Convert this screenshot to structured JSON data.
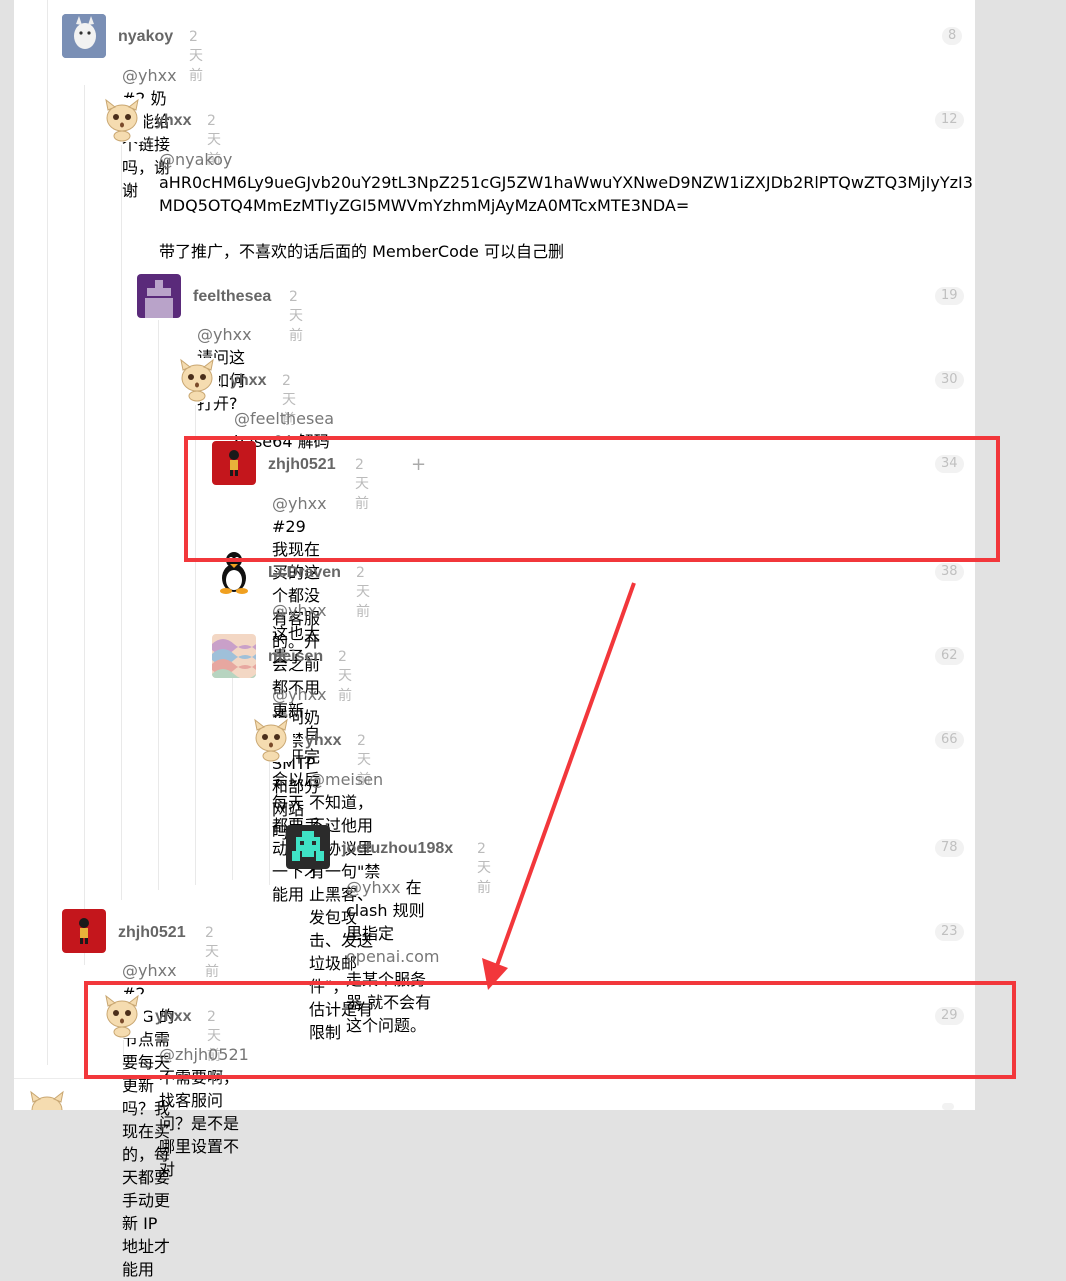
{
  "comments": [
    {
      "user": "nyakoy",
      "time": "2 天前",
      "floor": "8",
      "mention": "@yhxx",
      "text": " #2 奶昔能给个链接吗，谢谢"
    },
    {
      "user": "yhxx",
      "time": "2 天前",
      "floor": "12",
      "mention": "@nyakoy",
      "line1": "aHR0cHM6Ly9ueGJvb20uY29tL3NpZ251cGJ5ZW1haWwuYXNweD9NZW1iZXJDb2RlPTQwZTQ3MjIyYzI3",
      "line2": "MDQ5OTQ4MmEzMTIyZGI5MWVmYzhmMjAyMzA0MTcxMTE3NDA=",
      "line3": "带了推广，不喜欢的话后面的 MemberCode 可以自己删"
    },
    {
      "user": "feelthesea",
      "time": "2 天前",
      "floor": "19",
      "mention": "@yhxx",
      "text": " 请问这个如何打开?"
    },
    {
      "user": "yhxx",
      "time": "2 天前",
      "floor": "30",
      "mention": "@feelthesea",
      "text": " base64 解码"
    },
    {
      "user": "zhjh0521",
      "time": "2 天前",
      "plus": "+",
      "floor": "34",
      "mention": "@yhxx",
      "text": " #29 我现在买的这个都没有客服的。开会之前都不用更新的，自从开完会以后每天",
      "line2": "都要手动更新一下才能用"
    },
    {
      "user": "LcDraven",
      "time": "2 天前",
      "floor": "38",
      "mention": "@yhxx",
      "text": " 这也太贵了"
    },
    {
      "user": "meisen",
      "time": "2 天前",
      "floor": "62",
      "mention": "@yhxx",
      "text": " 请问奶昔禁 SMTP 和部分网站吗?"
    },
    {
      "user": "yhxx",
      "time": "2 天前",
      "floor": "66",
      "mention": "@meisen",
      "text": " 不知道，不过他用户协议里有一句\"禁止黑客、发包攻击、发送垃圾邮件\"，",
      "line2": "估计是有限制"
    },
    {
      "user": "joefuzhou198x",
      "time": "2 天前",
      "floor": "78",
      "mention": "@yhxx",
      "pre": " 在 clash 规则里指定 ",
      "link": "openai.com",
      "post": " 走某个服务器 就不会有这个问题。"
    },
    {
      "user": "zhjh0521",
      "time": "2 天前",
      "floor": "23",
      "mention": "@yhxx",
      "text": " #2 TAG 的节点需要每天更新吗？我现在买的，每天都要手动更新 IP 地址才能用"
    },
    {
      "user": "yhxx",
      "time": "2 天前",
      "floor": "29",
      "mention": "@zhjh0521",
      "text": " 不需要啊，找客服问问？是不是哪里设置不对"
    }
  ],
  "colors": {
    "annotation": "#f2373b",
    "background": "#e2e2e2",
    "panel": "#ffffff"
  }
}
